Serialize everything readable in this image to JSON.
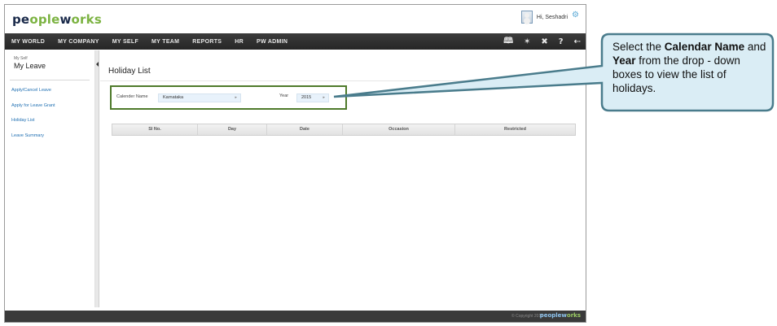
{
  "header": {
    "logo_part1": "pe",
    "logo_part2": "ople",
    "logo_part3": "w",
    "logo_part4": "orks",
    "greeting": "Hi, Seshadri"
  },
  "nav": {
    "items": [
      "MY WORLD",
      "MY COMPANY",
      "MY SELF",
      "MY TEAM",
      "REPORTS",
      "HR",
      "PW ADMIN"
    ],
    "icons": [
      "book-icon",
      "pin-icon",
      "tools-icon",
      "help-icon",
      "logout-icon"
    ]
  },
  "sidebar": {
    "breadcrumb": "My Self",
    "title": "My Leave",
    "items": [
      "Apply/Cancel Leave",
      "Apply for Leave Grant",
      "Holiday List",
      "Leave Summary"
    ]
  },
  "main": {
    "page_title": "Holiday List",
    "filters": {
      "calendar_label": "Calender Name",
      "calendar_value": "Karnataka",
      "year_label": "Year",
      "year_value": "2015"
    },
    "table": {
      "columns": [
        "Sl No.",
        "Day",
        "Date",
        "Occasion",
        "Restricted"
      ]
    }
  },
  "footer": {
    "copyright": "© Copyright 2015",
    "logo_part1": "peoplew",
    "logo_part2": "orks"
  },
  "callout": {
    "t1": "Select the ",
    "b1": "Calendar Name",
    "t2": " and ",
    "b2": "Year",
    "t3": " from the drop - down boxes to  view the list of holidays.",
    "fill": "#daedf5",
    "stroke": "#4a7c8c"
  }
}
